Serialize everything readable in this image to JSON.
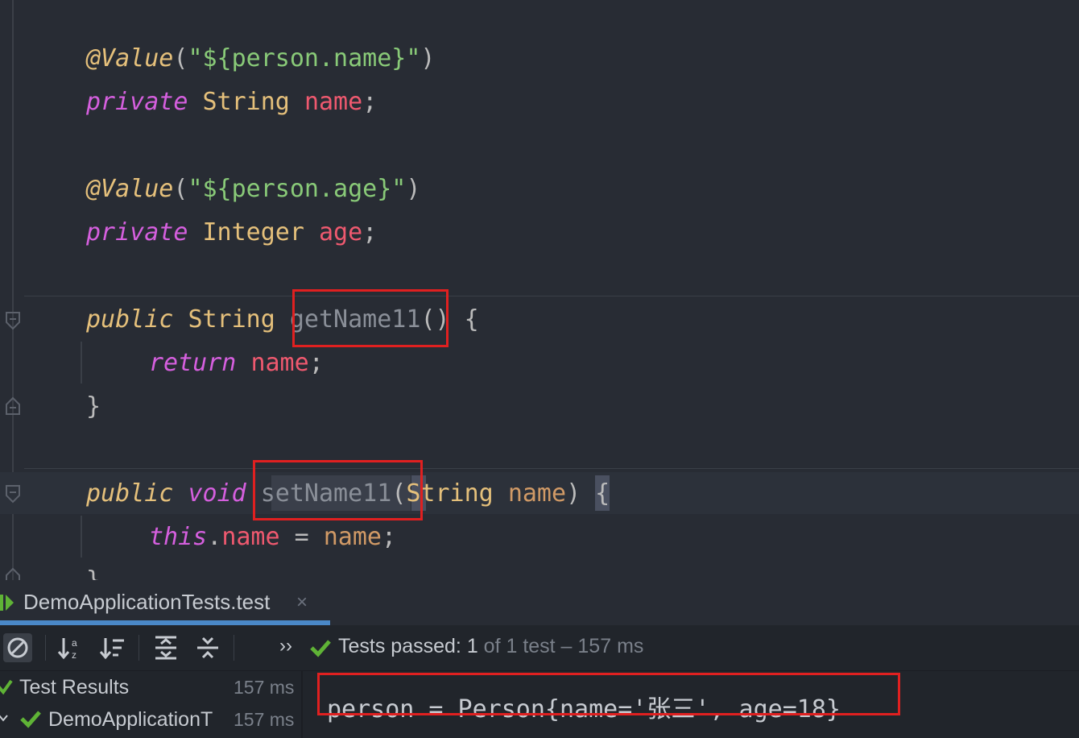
{
  "editor": {
    "line1": {
      "annotation": "@Value",
      "open": "(",
      "string": "\"${person.name}\"",
      "close": ")"
    },
    "line2": {
      "modifier": "private",
      "type": "String",
      "field": "name",
      "semi": ";"
    },
    "line3": {
      "annotation": "@Value",
      "open": "(",
      "string": "\"${person.age}\"",
      "close": ")"
    },
    "line4": {
      "modifier": "private",
      "type": "Integer",
      "field": "age",
      "semi": ";"
    },
    "line5": {
      "modifier": "public",
      "type": "String",
      "method": "getName11",
      "rest": "() {"
    },
    "line6": {
      "keyword": "return",
      "field": "name",
      "semi": ";"
    },
    "line7": {
      "brace": "}"
    },
    "line8": {
      "modifier": "public",
      "type": "void",
      "method": "setName11",
      "open": "(",
      "ptype": "String",
      "param": "name",
      "close": ")",
      "rest": " {"
    },
    "line9": {
      "keyword": "this",
      "dot": ".",
      "field": "name",
      "assign": " = ",
      "value": "name",
      "semi": ";"
    },
    "line10": {
      "brace": "}"
    }
  },
  "run_panel": {
    "tab_title": "DemoApplicationTests.test",
    "close_glyph": "×",
    "chevrons": "››",
    "status_passed": "Tests passed:",
    "status_count": "1",
    "status_rest": "of 1 test – 157 ms",
    "tree": [
      {
        "label": "Test Results",
        "time": "157 ms"
      },
      {
        "label": "DemoApplicationT",
        "time": "157 ms"
      }
    ],
    "console_output": "person = Person{name='张三', age=18}"
  },
  "colors": {
    "background": "#282c34",
    "highlight_box": "#e02020",
    "passed_check": "#5fb336",
    "tab_accent": "#4a88c7"
  },
  "icons": [
    "stop-icon",
    "sort-alpha-icon",
    "sort-duration-icon",
    "expand-all-icon",
    "collapse-all-icon",
    "check-icon",
    "run-tab-icon",
    "close-icon"
  ]
}
